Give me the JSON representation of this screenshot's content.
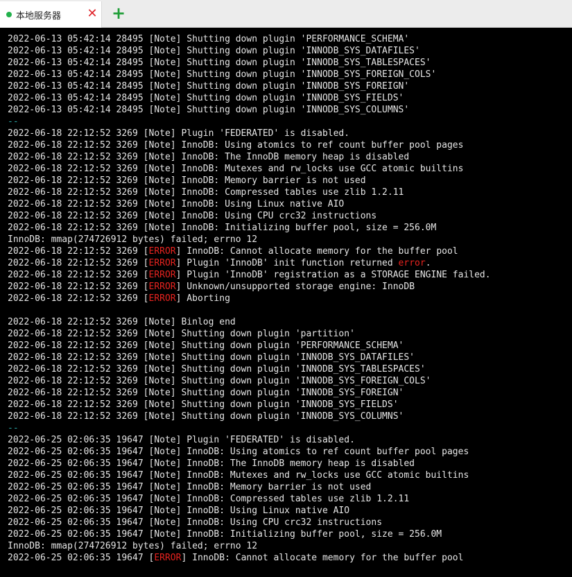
{
  "tabs": {
    "active_label": "本地服务器",
    "close_glyph": "✕",
    "add_glyph": "+"
  },
  "colors": {
    "background": "#000000",
    "text": "#e6e6e6",
    "error": "#e8231f",
    "separator": "#2aa3a3",
    "status_dot": "#22b14c"
  },
  "log": [
    {
      "text": "2022-06-13 05:42:14 28495 [Note] Shutting down plugin 'PERFORMANCE_SCHEMA'"
    },
    {
      "text": "2022-06-13 05:42:14 28495 [Note] Shutting down plugin 'INNODB_SYS_DATAFILES'"
    },
    {
      "text": "2022-06-13 05:42:14 28495 [Note] Shutting down plugin 'INNODB_SYS_TABLESPACES'"
    },
    {
      "text": "2022-06-13 05:42:14 28495 [Note] Shutting down plugin 'INNODB_SYS_FOREIGN_COLS'"
    },
    {
      "text": "2022-06-13 05:42:14 28495 [Note] Shutting down plugin 'INNODB_SYS_FOREIGN'"
    },
    {
      "text": "2022-06-13 05:42:14 28495 [Note] Shutting down plugin 'INNODB_SYS_FIELDS'"
    },
    {
      "text": "2022-06-13 05:42:14 28495 [Note] Shutting down plugin 'INNODB_SYS_COLUMNS'"
    },
    {
      "text": "--",
      "kind": "sep"
    },
    {
      "text": "2022-06-18 22:12:52 3269 [Note] Plugin 'FEDERATED' is disabled."
    },
    {
      "text": "2022-06-18 22:12:52 3269 [Note] InnoDB: Using atomics to ref count buffer pool pages"
    },
    {
      "text": "2022-06-18 22:12:52 3269 [Note] InnoDB: The InnoDB memory heap is disabled"
    },
    {
      "text": "2022-06-18 22:12:52 3269 [Note] InnoDB: Mutexes and rw_locks use GCC atomic builtins"
    },
    {
      "text": "2022-06-18 22:12:52 3269 [Note] InnoDB: Memory barrier is not used"
    },
    {
      "text": "2022-06-18 22:12:52 3269 [Note] InnoDB: Compressed tables use zlib 1.2.11"
    },
    {
      "text": "2022-06-18 22:12:52 3269 [Note] InnoDB: Using Linux native AIO"
    },
    {
      "text": "2022-06-18 22:12:52 3269 [Note] InnoDB: Using CPU crc32 instructions"
    },
    {
      "text": "2022-06-18 22:12:52 3269 [Note] InnoDB: Initializing buffer pool, size = 256.0M"
    },
    {
      "text": "InnoDB: mmap(274726912 bytes) failed; errno 12"
    },
    {
      "text": "2022-06-18 22:12:52 3269 [ERROR] InnoDB: Cannot allocate memory for the buffer pool"
    },
    {
      "text": "2022-06-18 22:12:52 3269 [ERROR] Plugin 'InnoDB' init function returned error."
    },
    {
      "text": "2022-06-18 22:12:52 3269 [ERROR] Plugin 'InnoDB' registration as a STORAGE ENGINE failed."
    },
    {
      "text": "2022-06-18 22:12:52 3269 [ERROR] Unknown/unsupported storage engine: InnoDB"
    },
    {
      "text": "2022-06-18 22:12:52 3269 [ERROR] Aborting"
    },
    {
      "text": ""
    },
    {
      "text": "2022-06-18 22:12:52 3269 [Note] Binlog end"
    },
    {
      "text": "2022-06-18 22:12:52 3269 [Note] Shutting down plugin 'partition'"
    },
    {
      "text": "2022-06-18 22:12:52 3269 [Note] Shutting down plugin 'PERFORMANCE_SCHEMA'"
    },
    {
      "text": "2022-06-18 22:12:52 3269 [Note] Shutting down plugin 'INNODB_SYS_DATAFILES'"
    },
    {
      "text": "2022-06-18 22:12:52 3269 [Note] Shutting down plugin 'INNODB_SYS_TABLESPACES'"
    },
    {
      "text": "2022-06-18 22:12:52 3269 [Note] Shutting down plugin 'INNODB_SYS_FOREIGN_COLS'"
    },
    {
      "text": "2022-06-18 22:12:52 3269 [Note] Shutting down plugin 'INNODB_SYS_FOREIGN'"
    },
    {
      "text": "2022-06-18 22:12:52 3269 [Note] Shutting down plugin 'INNODB_SYS_FIELDS'"
    },
    {
      "text": "2022-06-18 22:12:52 3269 [Note] Shutting down plugin 'INNODB_SYS_COLUMNS'"
    },
    {
      "text": "--",
      "kind": "sep"
    },
    {
      "text": "2022-06-25 02:06:35 19647 [Note] Plugin 'FEDERATED' is disabled."
    },
    {
      "text": "2022-06-25 02:06:35 19647 [Note] InnoDB: Using atomics to ref count buffer pool pages"
    },
    {
      "text": "2022-06-25 02:06:35 19647 [Note] InnoDB: The InnoDB memory heap is disabled"
    },
    {
      "text": "2022-06-25 02:06:35 19647 [Note] InnoDB: Mutexes and rw_locks use GCC atomic builtins"
    },
    {
      "text": "2022-06-25 02:06:35 19647 [Note] InnoDB: Memory barrier is not used"
    },
    {
      "text": "2022-06-25 02:06:35 19647 [Note] InnoDB: Compressed tables use zlib 1.2.11"
    },
    {
      "text": "2022-06-25 02:06:35 19647 [Note] InnoDB: Using Linux native AIO"
    },
    {
      "text": "2022-06-25 02:06:35 19647 [Note] InnoDB: Using CPU crc32 instructions"
    },
    {
      "text": "2022-06-25 02:06:35 19647 [Note] InnoDB: Initializing buffer pool, size = 256.0M"
    },
    {
      "text": "InnoDB: mmap(274726912 bytes) failed; errno 12"
    },
    {
      "text": "2022-06-25 02:06:35 19647 [ERROR] InnoDB: Cannot allocate memory for the buffer pool"
    }
  ]
}
